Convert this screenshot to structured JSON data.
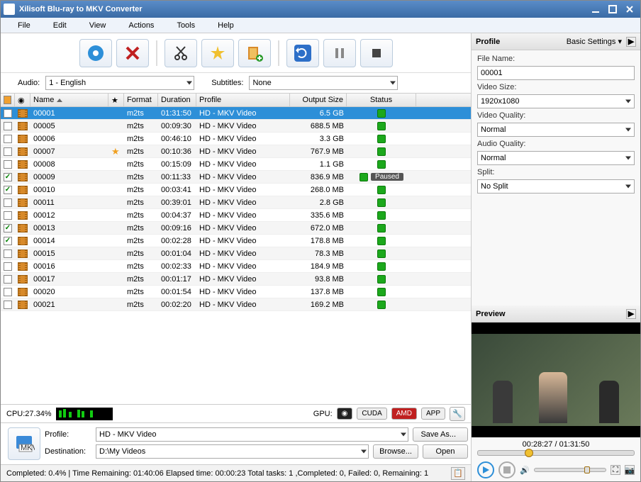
{
  "window": {
    "title": "Xilisoft Blu-ray to MKV Converter"
  },
  "menu": [
    "File",
    "Edit",
    "View",
    "Actions",
    "Tools",
    "Help"
  ],
  "selectors": {
    "audio_label": "Audio:",
    "audio_value": "1 - English",
    "subtitles_label": "Subtitles:",
    "subtitles_value": "None"
  },
  "columns": {
    "name": "Name",
    "format": "Format",
    "duration": "Duration",
    "profile": "Profile",
    "output_size": "Output Size",
    "status": "Status"
  },
  "rows": [
    {
      "chk": false,
      "name": "00001",
      "star": false,
      "format": "m2ts",
      "duration": "01:31:50",
      "profile": "HD - MKV Video",
      "size": "6.5 GB",
      "status": "green",
      "selected": true
    },
    {
      "chk": false,
      "name": "00005",
      "star": false,
      "format": "m2ts",
      "duration": "00:09:30",
      "profile": "HD - MKV Video",
      "size": "688.5 MB",
      "status": "green"
    },
    {
      "chk": false,
      "name": "00006",
      "star": false,
      "format": "m2ts",
      "duration": "00:46:10",
      "profile": "HD - MKV Video",
      "size": "3.3 GB",
      "status": "green"
    },
    {
      "chk": false,
      "name": "00007",
      "star": true,
      "format": "m2ts",
      "duration": "00:10:36",
      "profile": "HD - MKV Video",
      "size": "767.9 MB",
      "status": "green"
    },
    {
      "chk": false,
      "name": "00008",
      "star": false,
      "format": "m2ts",
      "duration": "00:15:09",
      "profile": "HD - MKV Video",
      "size": "1.1 GB",
      "status": "green"
    },
    {
      "chk": true,
      "name": "00009",
      "star": false,
      "format": "m2ts",
      "duration": "00:11:33",
      "profile": "HD - MKV Video",
      "size": "836.9 MB",
      "status": "paused",
      "status_text": "Paused"
    },
    {
      "chk": true,
      "name": "00010",
      "star": false,
      "format": "m2ts",
      "duration": "00:03:41",
      "profile": "HD - MKV Video",
      "size": "268.0 MB",
      "status": "green"
    },
    {
      "chk": false,
      "name": "00011",
      "star": false,
      "format": "m2ts",
      "duration": "00:39:01",
      "profile": "HD - MKV Video",
      "size": "2.8 GB",
      "status": "green"
    },
    {
      "chk": false,
      "name": "00012",
      "star": false,
      "format": "m2ts",
      "duration": "00:04:37",
      "profile": "HD - MKV Video",
      "size": "335.6 MB",
      "status": "green"
    },
    {
      "chk": true,
      "name": "00013",
      "star": false,
      "format": "m2ts",
      "duration": "00:09:16",
      "profile": "HD - MKV Video",
      "size": "672.0 MB",
      "status": "green"
    },
    {
      "chk": true,
      "name": "00014",
      "star": false,
      "format": "m2ts",
      "duration": "00:02:28",
      "profile": "HD - MKV Video",
      "size": "178.8 MB",
      "status": "green"
    },
    {
      "chk": false,
      "name": "00015",
      "star": false,
      "format": "m2ts",
      "duration": "00:01:04",
      "profile": "HD - MKV Video",
      "size": "78.3 MB",
      "status": "green"
    },
    {
      "chk": false,
      "name": "00016",
      "star": false,
      "format": "m2ts",
      "duration": "00:02:33",
      "profile": "HD - MKV Video",
      "size": "184.9 MB",
      "status": "green"
    },
    {
      "chk": false,
      "name": "00017",
      "star": false,
      "format": "m2ts",
      "duration": "00:01:17",
      "profile": "HD - MKV Video",
      "size": "93.8 MB",
      "status": "green"
    },
    {
      "chk": false,
      "name": "00020",
      "star": false,
      "format": "m2ts",
      "duration": "00:01:54",
      "profile": "HD - MKV Video",
      "size": "137.8 MB",
      "status": "green"
    },
    {
      "chk": false,
      "name": "00021",
      "star": false,
      "format": "m2ts",
      "duration": "00:02:20",
      "profile": "HD - MKV Video",
      "size": "169.2 MB",
      "status": "green"
    }
  ],
  "cpu": {
    "label": "CPU:27.34%"
  },
  "gpu": {
    "label": "GPU:",
    "cuda": "CUDA",
    "amd": "AMD",
    "app": "APP"
  },
  "profile_bar": {
    "profile_label": "Profile:",
    "profile_value": "HD - MKV Video",
    "save_as": "Save As...",
    "destination_label": "Destination:",
    "destination_value": "D:\\My Videos",
    "browse": "Browse...",
    "open": "Open"
  },
  "statusbar": {
    "text": "Completed: 0.4% | Time Remaining: 01:40:06 Elapsed time: 00:00:23 Total tasks: 1 ,Completed: 0, Failed: 0, Remaining: 1"
  },
  "right": {
    "profile_head": "Profile",
    "basic_settings": "Basic Settings",
    "file_name_label": "File Name:",
    "file_name_value": "00001",
    "video_size_label": "Video Size:",
    "video_size_value": "1920x1080",
    "video_quality_label": "Video Quality:",
    "video_quality_value": "Normal",
    "audio_quality_label": "Audio Quality:",
    "audio_quality_value": "Normal",
    "split_label": "Split:",
    "split_value": "No Split",
    "preview_head": "Preview",
    "time": "00:28:27 / 01:31:50"
  }
}
